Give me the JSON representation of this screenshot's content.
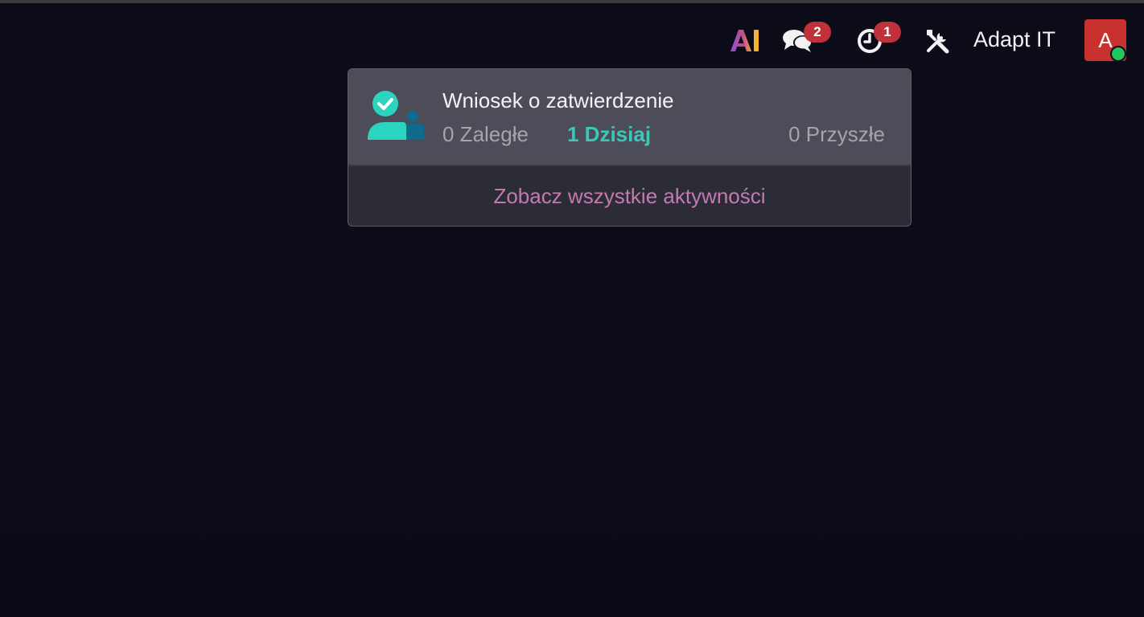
{
  "navbar": {
    "ai_label": "AI",
    "messages_badge": "2",
    "activities_badge": "1",
    "company_name": "Adapt IT",
    "avatar_initial": "A"
  },
  "activity_dropdown": {
    "title": "Wniosek o zatwierdzenie",
    "overdue": "0 Zaległe",
    "today": "1 Dzisiaj",
    "future": "0 Przyszłe",
    "view_all": "Zobacz wszystkie aktywności"
  },
  "colors": {
    "background": "#0d0d1a",
    "badge": "#c0313a",
    "avatar": "#c7322f",
    "presence": "#22c55e",
    "today_accent": "#3cc8b8",
    "link_accent": "#c27ab0"
  }
}
